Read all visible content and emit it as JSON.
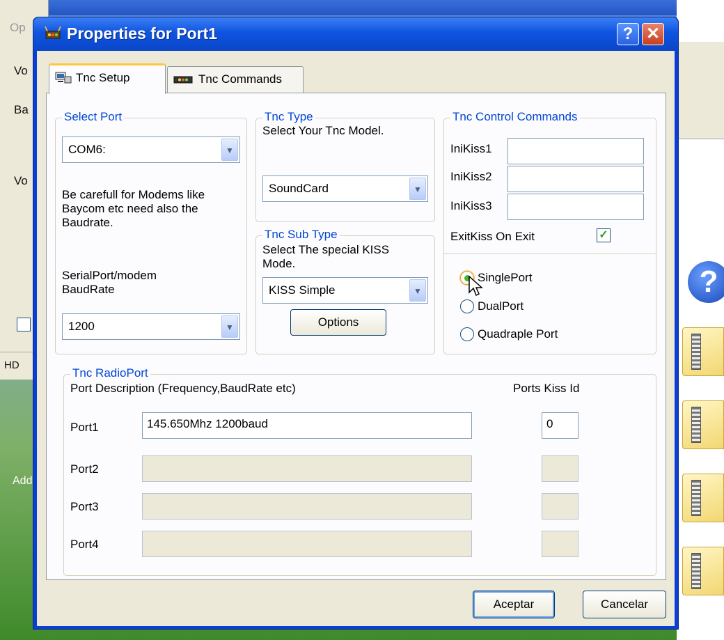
{
  "background_app": {
    "left_labels": [
      "Op",
      "Vo",
      "Ba",
      "Vo",
      "HD",
      "Add"
    ],
    "right_icons": [
      "folder-icon",
      "help-icon"
    ]
  },
  "dialog": {
    "title": "Properties for Port1",
    "help_glyph": "?",
    "close_glyph": "✕",
    "tabs": [
      {
        "label": "Tnc Setup",
        "active": true,
        "icon": "tnc-setup-icon"
      },
      {
        "label": "Tnc Commands",
        "active": false,
        "icon": "tnc-device-icon"
      }
    ],
    "select_port": {
      "legend": "Select Port",
      "port_value": "COM6:",
      "warning_line1": "Be carefull for Modems like",
      "warning_line2": "Baycom etc need also the",
      "warning_line3": "Baudrate.",
      "baud_label_line1": "SerialPort/modem",
      "baud_label_line2": "BaudRate",
      "baud_value": "1200"
    },
    "tnc_type": {
      "legend": "Tnc Type",
      "instruction": "Select Your Tnc Model.",
      "value": "SoundCard"
    },
    "tnc_sub_type": {
      "legend": "Tnc Sub Type",
      "instruction_line1": "Select The special KISS",
      "instruction_line2": "Mode.",
      "value": "KISS Simple",
      "options_button": "Options"
    },
    "tnc_control": {
      "legend": "Tnc Control Commands",
      "inikiss1_label": "IniKiss1",
      "inikiss2_label": "IniKiss2",
      "inikiss3_label": "IniKiss3",
      "inikiss1_value": "",
      "inikiss2_value": "",
      "inikiss3_value": "",
      "exit_kiss_label": "ExitKiss On Exit",
      "exit_kiss_checked": true,
      "check_glyph": "✓",
      "radios": [
        {
          "label": "SinglePort",
          "selected": true
        },
        {
          "label": "DualPort",
          "selected": false
        },
        {
          "label": "Quadraple Port",
          "selected": false
        }
      ]
    },
    "radio_port": {
      "legend": "Tnc RadioPort",
      "description_header": "Port Description (Frequency,BaudRate etc)",
      "kiss_id_header": "Ports Kiss Id",
      "ports": [
        {
          "label": "Port1",
          "description": "145.650Mhz 1200baud",
          "kiss_id": "0",
          "enabled": true
        },
        {
          "label": "Port2",
          "description": "",
          "kiss_id": "",
          "enabled": false
        },
        {
          "label": "Port3",
          "description": "",
          "kiss_id": "",
          "enabled": false
        },
        {
          "label": "Port4",
          "description": "",
          "kiss_id": "",
          "enabled": false
        }
      ]
    },
    "footer": {
      "ok_label": "Aceptar",
      "cancel_label": "Cancelar"
    }
  }
}
